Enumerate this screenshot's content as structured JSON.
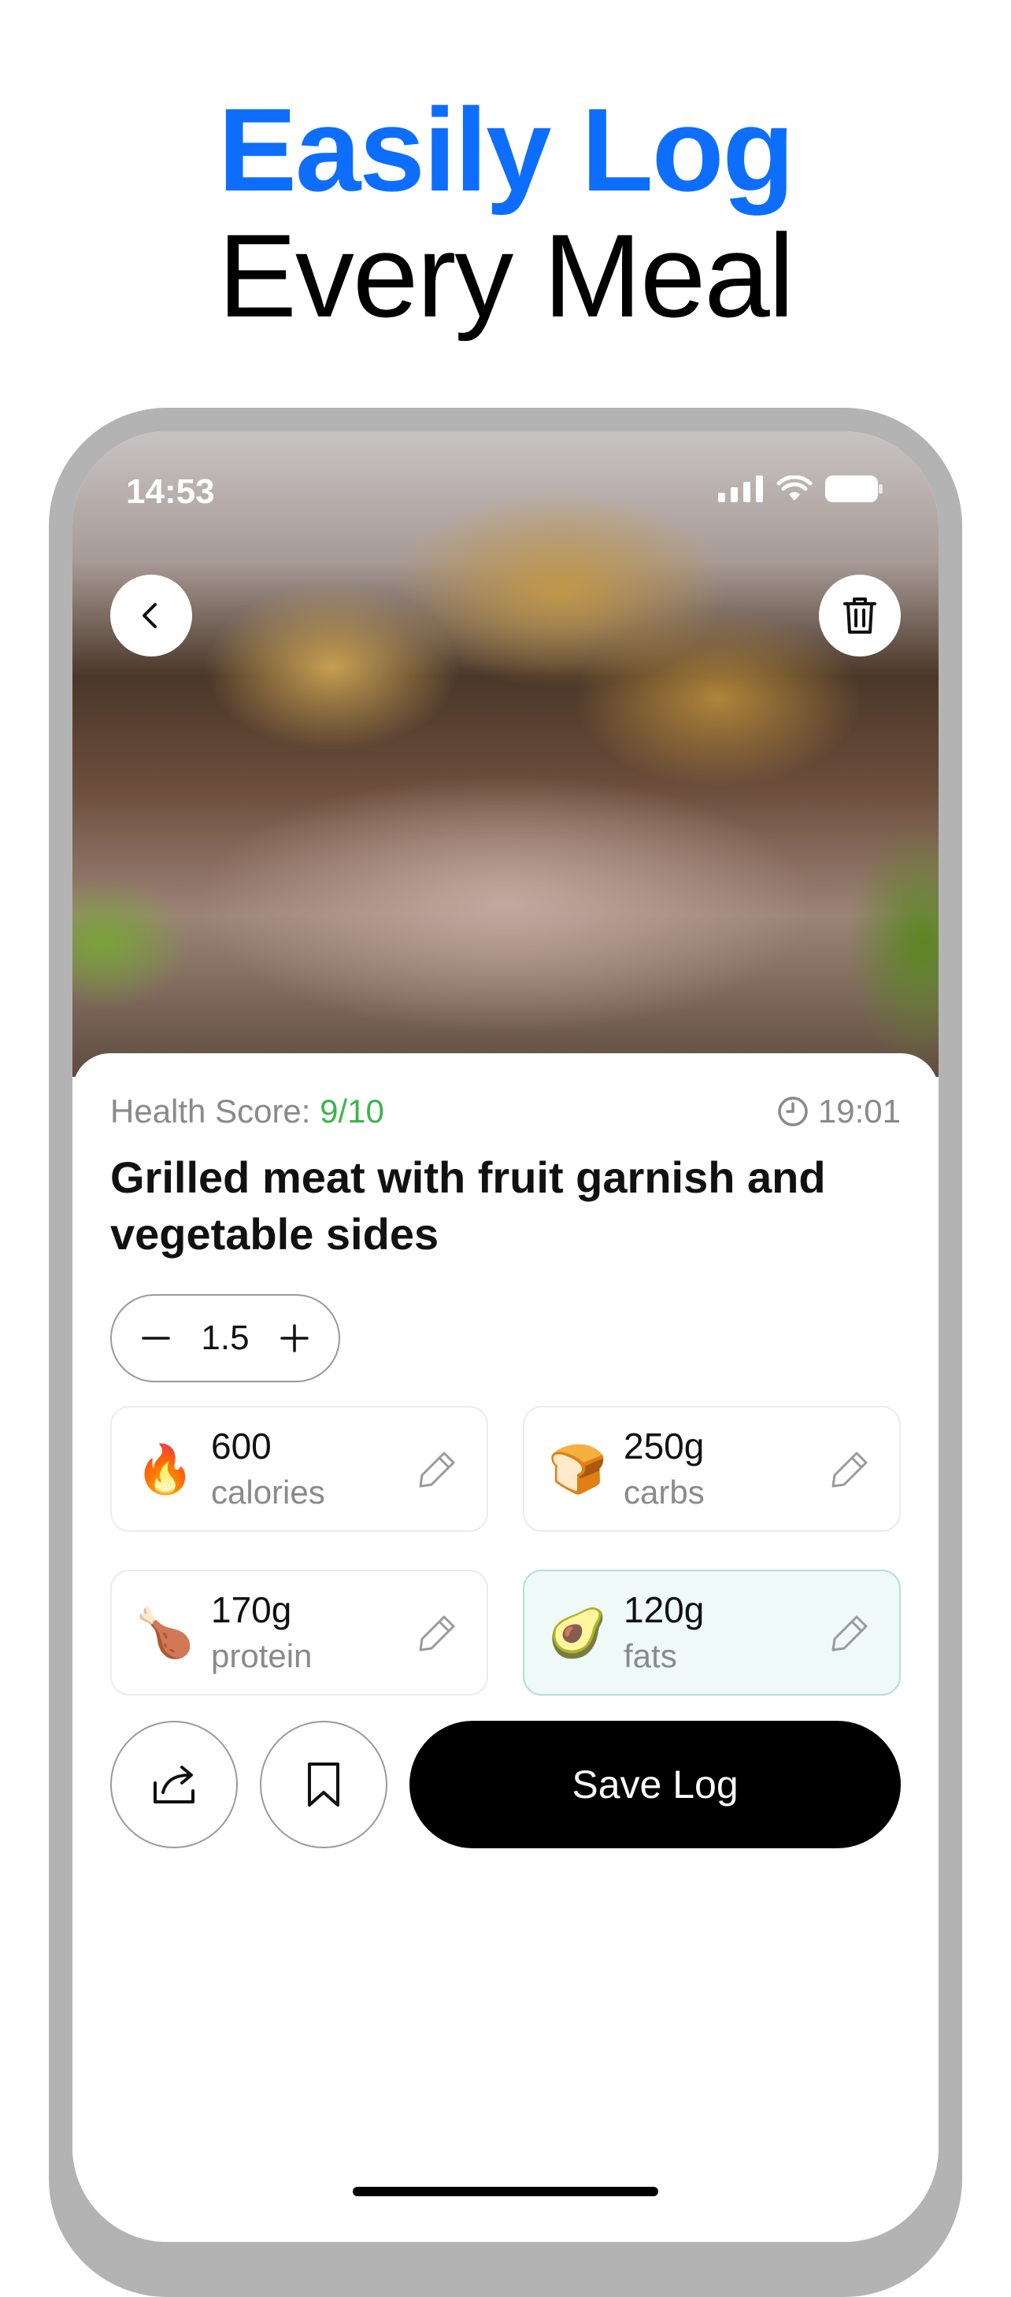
{
  "headline": {
    "line1": "Easily Log",
    "line2": "Every Meal",
    "accent_color": "#0d6efd"
  },
  "status_bar": {
    "time": "14:53",
    "icons": [
      "signal-icon",
      "wifi-icon",
      "battery-icon"
    ]
  },
  "top_buttons": {
    "back_icon": "chevron-left-icon",
    "delete_icon": "trash-icon"
  },
  "meal": {
    "health_label": "Health Score: ",
    "health_score": "9/10",
    "time": "19:01",
    "title": "Grilled meat with fruit garnish and vegetable sides",
    "servings": "1.5"
  },
  "nutrition": [
    {
      "icon": "🔥",
      "icon_name": "fire-icon",
      "value": "600",
      "label": "calories"
    },
    {
      "icon": "🍞",
      "icon_name": "bread-icon",
      "value": "250g",
      "label": "carbs"
    },
    {
      "icon": "🍗",
      "icon_name": "drumstick-icon",
      "value": "170g",
      "label": "protein"
    },
    {
      "icon": "🥑",
      "icon_name": "avocado-icon",
      "value": "120g",
      "label": "fats",
      "highlighted": true
    }
  ],
  "actions": {
    "share_icon": "share-icon",
    "bookmark_icon": "bookmark-icon",
    "save_label": "Save Log"
  },
  "colors": {
    "score_green": "#3cb54a",
    "button_black": "#000000",
    "fats_card_bg": "#eef9f8"
  }
}
